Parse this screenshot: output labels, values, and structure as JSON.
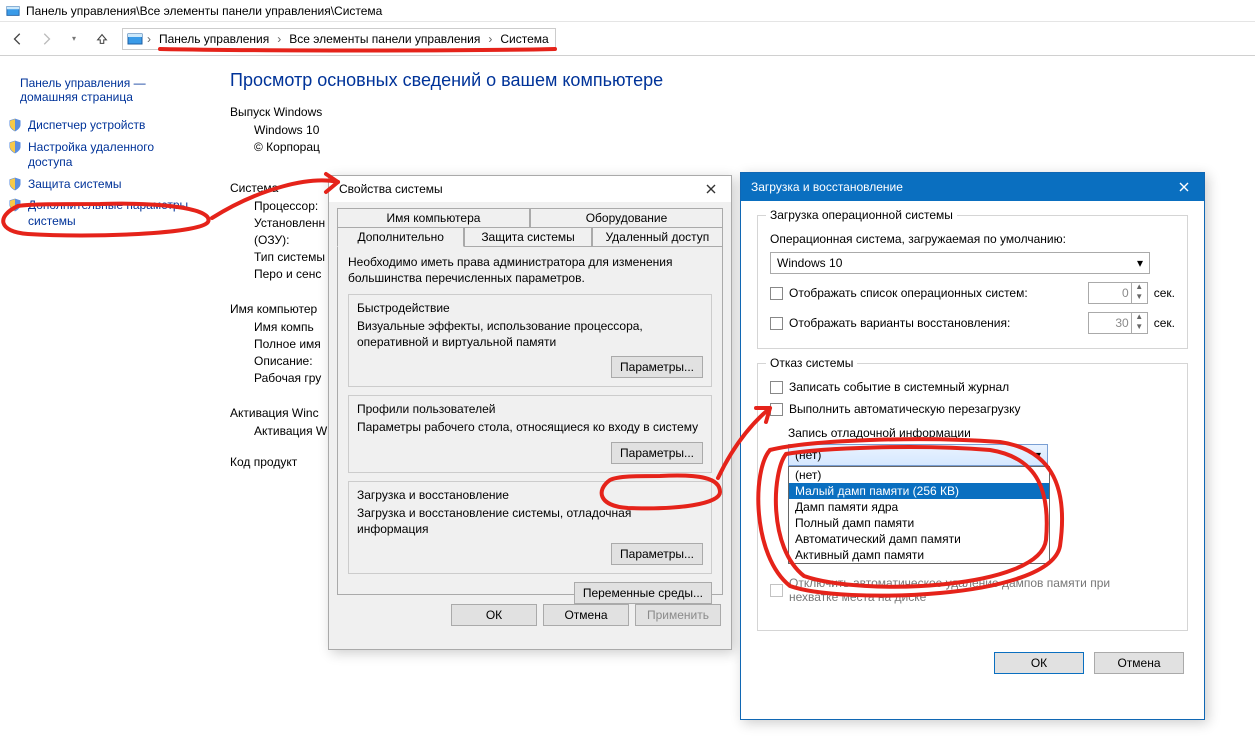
{
  "titlebar": "Панель управления\\Все элементы панели управления\\Система",
  "breadcrumbs": {
    "item0": "Панель управления",
    "item1": "Все элементы панели управления",
    "item2": "Система"
  },
  "sidebar": {
    "home1": "Панель управления —",
    "home2": "домашняя страница",
    "link0": "Диспетчер устройств",
    "link1a": "Настройка удаленного",
    "link1b": "доступа",
    "link2": "Защита системы",
    "link3a": "Дополнительные параметры",
    "link3b": "системы"
  },
  "main": {
    "title": "Просмотр основных сведений о вашем компьютере",
    "sec_edition": "Выпуск Windows",
    "edition": "Windows 10",
    "copyright": "© Корпорац",
    "sec_system": "Система",
    "proc_label": "Процессор:",
    "ram1": "Установленн",
    "ram2": "(ОЗУ):",
    "systype": "Тип системы",
    "pen": "Перо и сенс",
    "sec_name": "Имя компьютер",
    "compname": "Имя компь",
    "fullname": "Полное имя",
    "desc": "Описание:",
    "workgroup": "Рабочая гру",
    "sec_act": "Активация Winc",
    "act": "Активация W",
    "prod": "Код продукт"
  },
  "sysprops": {
    "title": "Свойства системы",
    "tab_comp": "Имя компьютера",
    "tab_hw": "Оборудование",
    "tab_adv": "Дополнительно",
    "tab_prot": "Защита системы",
    "tab_remote": "Удаленный доступ",
    "note": "Необходимо иметь права администратора для изменения большинства перечисленных параметров.",
    "g1_title": "Быстродействие",
    "g1_text": "Визуальные эффекты, использование процессора, оперативной и виртуальной памяти",
    "g_btn": "Параметры...",
    "g2_title": "Профили пользователей",
    "g2_text": "Параметры рабочего стола, относящиеся ко входу в систему",
    "g3_title": "Загрузка и восстановление",
    "g3_text": "Загрузка и восстановление системы, отладочная информация",
    "env_btn": "Переменные среды...",
    "ok": "ОК",
    "cancel": "Отмена",
    "apply": "Применить"
  },
  "startup": {
    "title": "Загрузка и восстановление",
    "fs1_title": "Загрузка операционной системы",
    "default_label": "Операционная система, загружаемая по умолчанию:",
    "default_value": "Windows 10",
    "cb_oslist": "Отображать список операционных систем:",
    "cb_oslist_sec": "0",
    "sec_unit": "сек.",
    "cb_recopts": "Отображать варианты восстановления:",
    "cb_recopts_sec": "30",
    "fs2_title": "Отказ системы",
    "cb_evtlog": "Записать событие в системный журнал",
    "cb_autorestart": "Выполнить автоматическую перезагрузку",
    "dbg_label": "Запись отладочной информации",
    "combo_value": "(нет)",
    "options": {
      "o0": "(нет)",
      "o1": "Малый дамп памяти (256 КВ)",
      "o2": "Дамп памяти ядра",
      "o3": "Полный дамп памяти",
      "o4": "Автоматический дамп памяти",
      "o5": "Активный дамп памяти"
    },
    "below": "Отключить автоматическое удаление дампов памяти при нехватке места на диске",
    "ok": "ОК",
    "cancel": "Отмена"
  }
}
